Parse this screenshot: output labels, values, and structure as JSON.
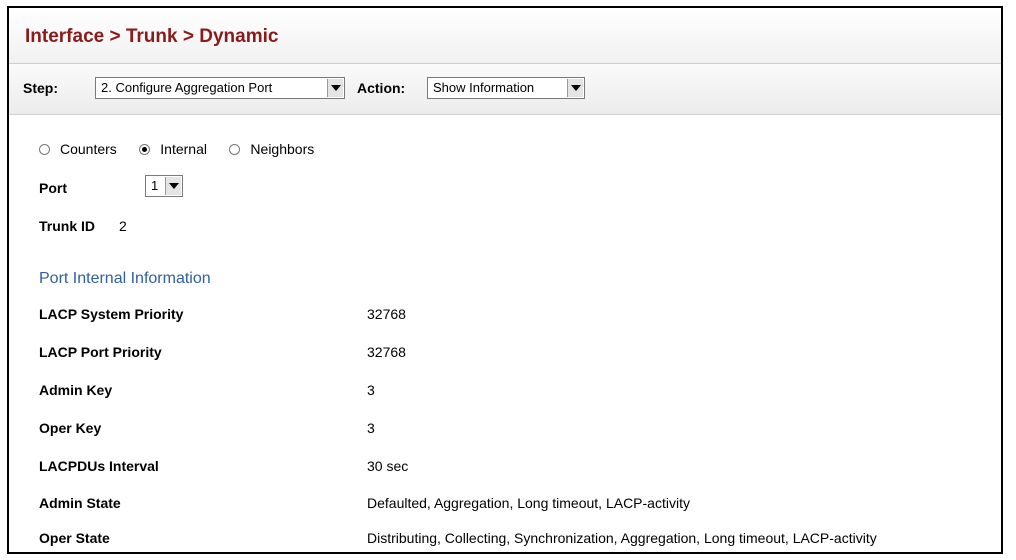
{
  "header": {
    "title": "Interface > Trunk > Dynamic"
  },
  "toolbar": {
    "step_label": "Step:",
    "step_value": "2. Configure Aggregation Port",
    "action_label": "Action:",
    "action_value": "Show Information"
  },
  "view_options": [
    {
      "label": "Counters",
      "checked": false
    },
    {
      "label": "Internal",
      "checked": true
    },
    {
      "label": "Neighbors",
      "checked": false
    }
  ],
  "port": {
    "label": "Port",
    "value": "1"
  },
  "trunk": {
    "label": "Trunk ID",
    "value": "2"
  },
  "section": {
    "title": "Port Internal Information"
  },
  "info_rows": [
    {
      "label": "LACP System Priority",
      "value": "32768"
    },
    {
      "label": "LACP Port Priority",
      "value": "32768"
    },
    {
      "label": "Admin Key",
      "value": "3"
    },
    {
      "label": "Oper Key",
      "value": "3"
    },
    {
      "label": "LACPDUs Interval",
      "value": "30 sec"
    },
    {
      "label": "Admin State",
      "value": "Defaulted, Aggregation, Long timeout, LACP-activity"
    },
    {
      "label": "Oper State",
      "value": "Distributing, Collecting, Synchronization, Aggregation, Long timeout, LACP-activity"
    }
  ]
}
